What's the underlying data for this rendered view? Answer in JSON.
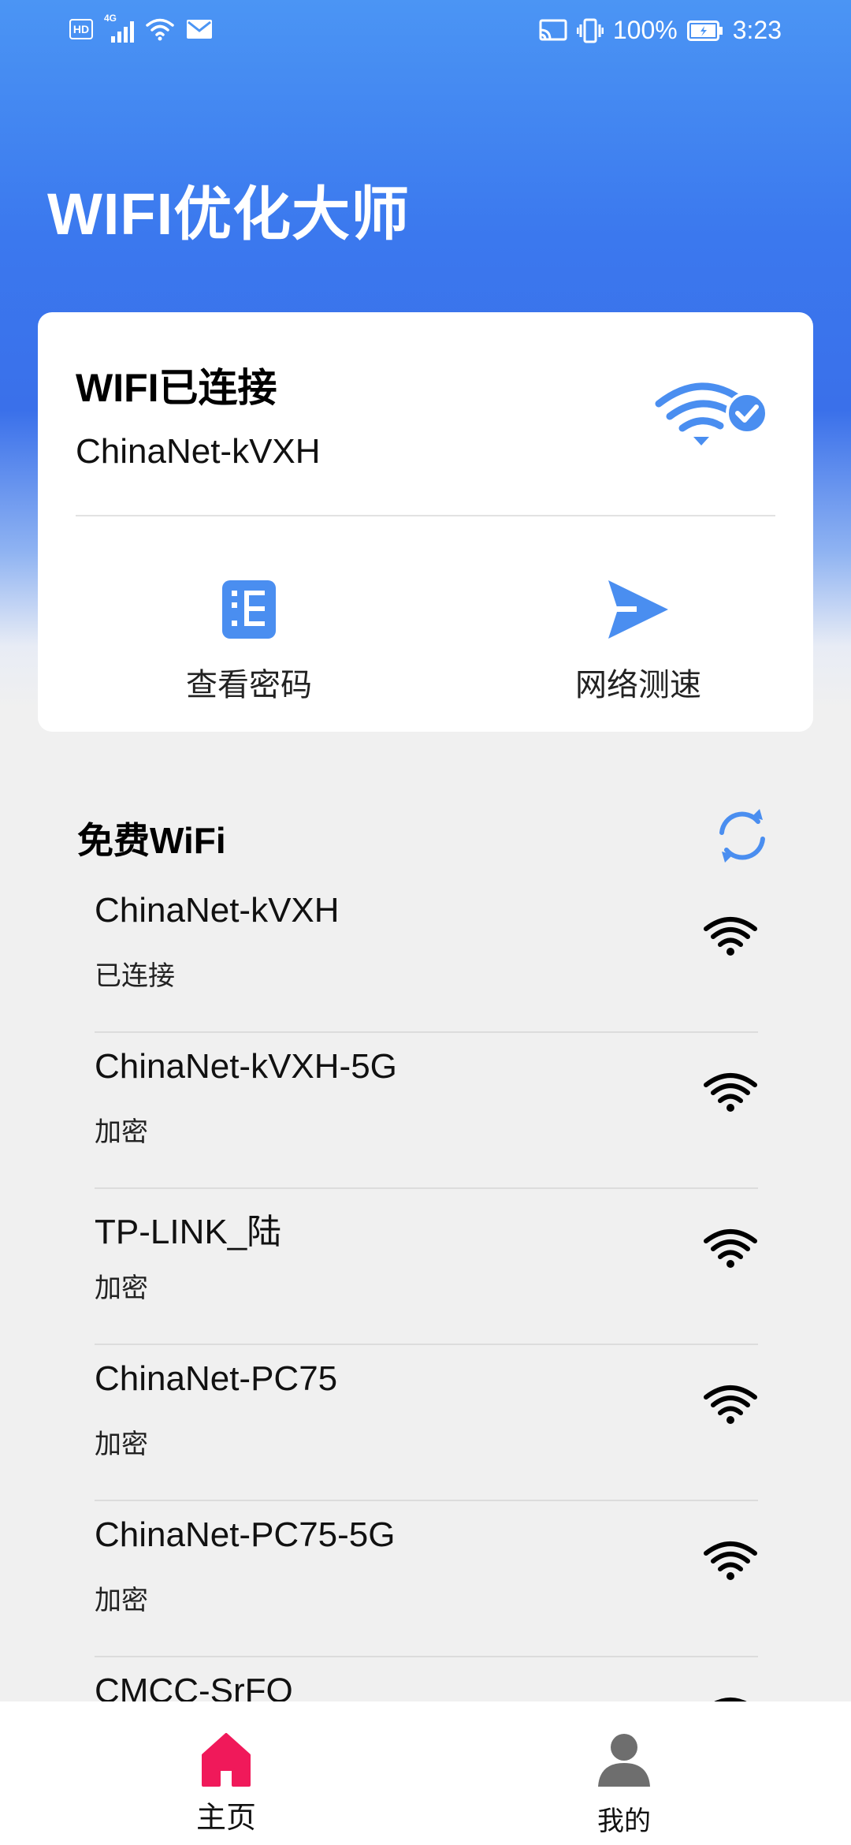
{
  "status_bar": {
    "hd_label": "HD",
    "network_label": "4G",
    "battery": "100%",
    "time": "3:23"
  },
  "header": {
    "title": "WIFI优化大师"
  },
  "connection_card": {
    "status": "WIFI已连接",
    "ssid": "ChinaNet-kVXH",
    "actions": [
      {
        "label": "查看密码",
        "icon": "password-list-icon"
      },
      {
        "label": "网络测速",
        "icon": "send-arrow-icon"
      }
    ]
  },
  "free_wifi": {
    "title": "免费WiFi",
    "networks": [
      {
        "ssid": "ChinaNet-kVXH",
        "state": "已连接"
      },
      {
        "ssid": "ChinaNet-kVXH-5G",
        "state": "加密"
      },
      {
        "ssid": "TP-LINK_陆",
        "state": "加密"
      },
      {
        "ssid": "ChinaNet-PC75",
        "state": "加密"
      },
      {
        "ssid": "ChinaNet-PC75-5G",
        "state": "加密"
      },
      {
        "ssid": "CMCC-SrFQ",
        "state": ""
      }
    ]
  },
  "bottom_nav": {
    "items": [
      {
        "label": "主页",
        "active": true
      },
      {
        "label": "我的",
        "active": false
      }
    ]
  },
  "colors": {
    "accent_blue": "#4a8ef0",
    "home_active": "#f0195a",
    "inactive_icon": "#6e6e6e"
  }
}
